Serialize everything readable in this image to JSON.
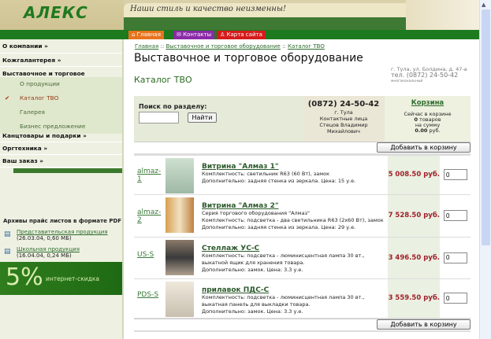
{
  "header": {
    "logo": "АЛЕКС",
    "slogan": "Наши стиль и качество неизменны!",
    "nav": [
      {
        "label": "Главная",
        "color": "#e8731e"
      },
      {
        "label": "Контакты",
        "color": "#8a2aa8"
      },
      {
        "label": "Карта сайта",
        "color": "#d51c1c"
      }
    ]
  },
  "sidebar": {
    "items": [
      {
        "label": "О компании »"
      },
      {
        "label": "Кожгалантерея »"
      },
      {
        "label": "Выставочное и торговое оборудование »"
      }
    ],
    "subitems": [
      {
        "label": "О продукции"
      },
      {
        "label": "Каталог ТВО"
      },
      {
        "label": "Галерея"
      },
      {
        "label": "Бизнес предложение"
      }
    ],
    "items2": [
      {
        "label": "Канцтовары и подарки »"
      },
      {
        "label": "Оргтехника »"
      },
      {
        "label": "Ваш заказ »"
      }
    ],
    "archive": {
      "title": "Архивы прайс листов в формате PDF",
      "files": [
        {
          "name": "Представительская продукция",
          "meta": "(26.03.04, 0,60 МБ)"
        },
        {
          "name": "Школьная продукция",
          "meta": "(16.04.04, 0,24 МБ)"
        }
      ]
    },
    "promo": {
      "value": "5%",
      "label": "интернет-скидка"
    }
  },
  "main": {
    "breadcrumb": [
      "Главная",
      "Выставочное и торговое оборудование",
      "Каталог ТВО"
    ],
    "breadcrumb_sep": "::",
    "title": "Выставочное и торговое оборудование",
    "subtitle": "Каталог ТВО",
    "address": {
      "line1": "г. Тула, ул. Болдина, д. 47-а",
      "line2": "тел. (0872) 24-50-42",
      "line3": "многоканальный"
    },
    "search": {
      "label": "Поиск по разделу:",
      "value": "",
      "button": "Найти"
    },
    "contact": {
      "phone": "(0872) 24-50-42",
      "city": "г. Тула",
      "label": "Контактные лица",
      "person1": "Стецов Владимир",
      "person2": "Михайлович"
    },
    "cart": {
      "title": "Корзина",
      "line1": "Сейчас в корзине",
      "count": "0",
      "line2": "товаров",
      "line3": "на сумму",
      "sum": "0.00",
      "currency": "руб."
    },
    "add_button": "Добавить в корзину",
    "products": [
      {
        "code": "almaz-1",
        "name": "Витрина \"Алмаз 1\"",
        "desc": [
          "Комплектность: светильник R63 (60 Вт), замок",
          "Дополнительно: задняя стенка из зеркала. Цена: 15 у.е."
        ],
        "price": "5 008.50 руб.",
        "qty": "0"
      },
      {
        "code": "almaz-2",
        "name": "Витрина \"Алмаз 2\"",
        "desc": [
          "Серия торгового оборудования \"Алмаз\"",
          "Комплектность: подсветка - два светильника R63 (2x60 Вт), замок",
          "Дополнительно: задняя стенка из зеркала. Цена: 29 у.е."
        ],
        "price": "7 528.50 руб.",
        "qty": "0"
      },
      {
        "code": "US-S",
        "name": "Стеллаж УС-С",
        "desc": [
          "Комплектность: подсветка - люминисцентная лампа 30 вт., выкатной ящик для хранения товара.",
          "Дополнительно: замок. Цена: 3.3 у.е."
        ],
        "price": "3 496.50 руб.",
        "qty": "0"
      },
      {
        "code": "PDS-S",
        "name": "прилавок ПДС-С",
        "desc": [
          "Комплектность: подсветка - люминисцентная лампа 30 вт., выкатная панель для выкладки товара.",
          "Дополнительно: замок. Цена: 3.3 у.е."
        ],
        "price": "3 559.50 руб.",
        "qty": "0"
      }
    ]
  }
}
